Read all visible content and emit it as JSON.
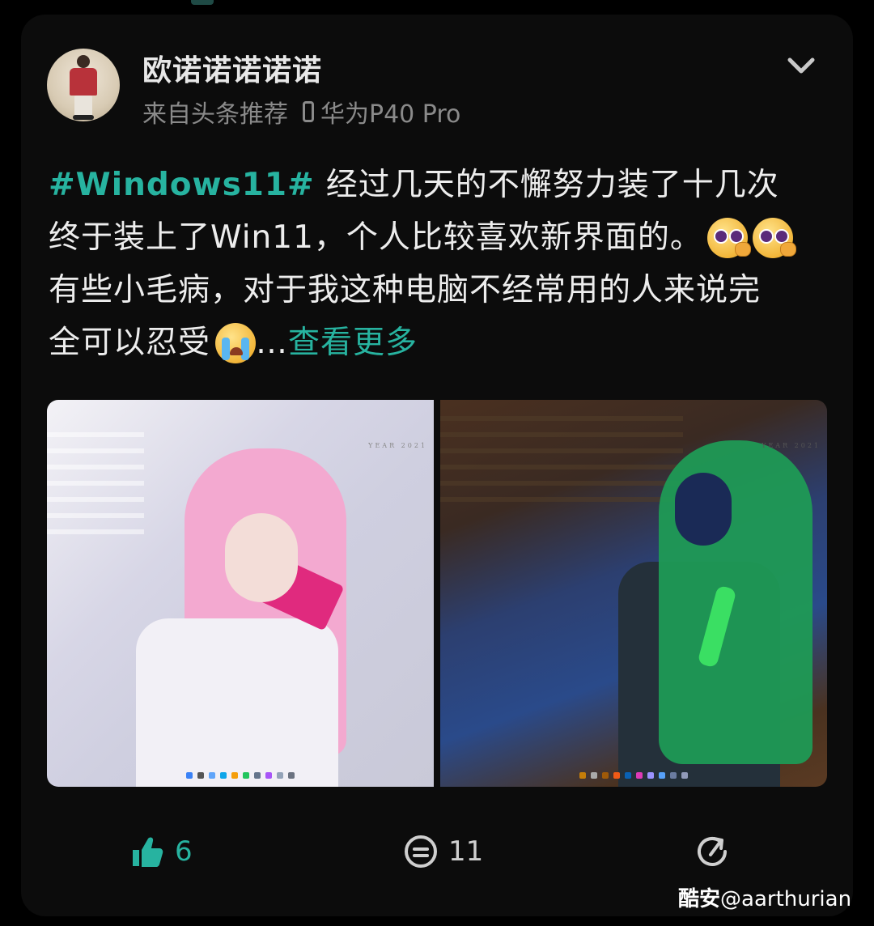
{
  "post": {
    "author": {
      "name": "欧诺诺诺诺诺",
      "source": "来自头条推荐",
      "device": "华为P40 Pro"
    },
    "hashtag": "#Windows11#",
    "lines": [
      "经过几天的不懈努力装了十几次",
      "终于装上了Win11，个人比较喜欢新界面的。",
      "有些小毛病，对于我这种电脑不经常用的人来说完",
      "全可以忍受"
    ],
    "ellipsis": "…",
    "more_label": "查看更多",
    "photo_watermark": "YEAR 2021",
    "emojis": [
      "smirk-face-icon",
      "smirk-face-icon",
      "crying-face-icon"
    ]
  },
  "actions": {
    "like_count": "6",
    "comment_count": "11"
  },
  "footer": {
    "app_name": "酷安",
    "handle": "@aarthurian"
  },
  "colors": {
    "accent": "#27b3a0",
    "card": "#0c0c0c",
    "background": "#000000"
  }
}
